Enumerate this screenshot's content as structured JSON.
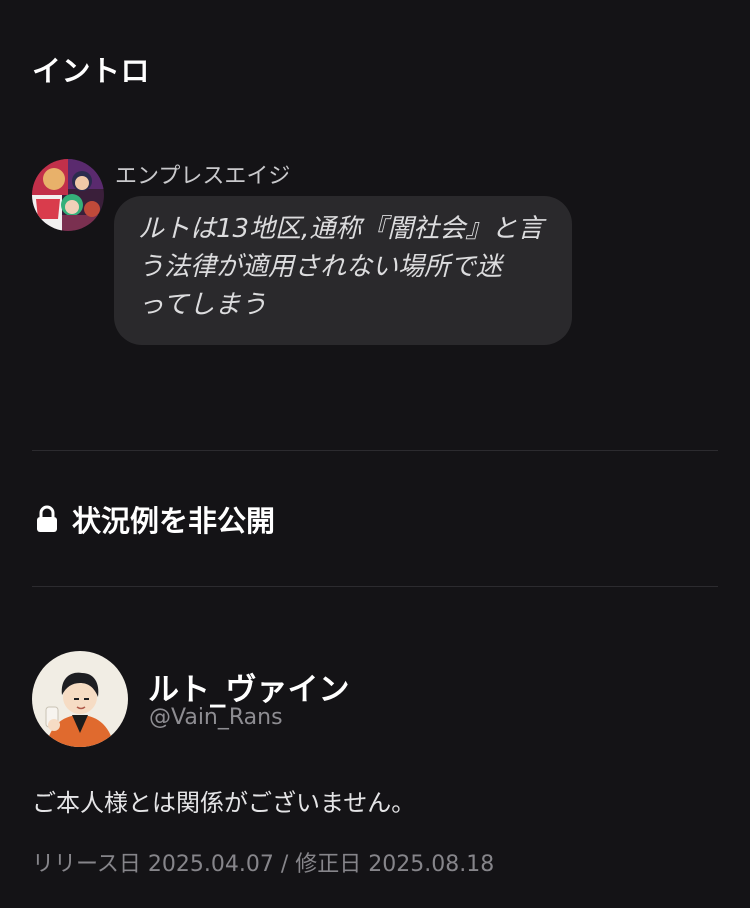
{
  "intro": {
    "title": "イントロ",
    "speaker_name": "エンプレスエイジ",
    "message_lines": [
      "ルトは13地区,通称『闇社会』と言",
      "う法律が適用されない場所で迷",
      "ってしまう"
    ]
  },
  "situations": {
    "lock_icon": "lock-icon",
    "label": "状況例を非公開"
  },
  "creator": {
    "name": "ルト_ヴァイン",
    "handle": "@Vain_Rans",
    "disclaimer": "ご本人様とは関係がございません。",
    "dates": "リリース日 2025.04.07 / 修正日 2025.08.18"
  }
}
